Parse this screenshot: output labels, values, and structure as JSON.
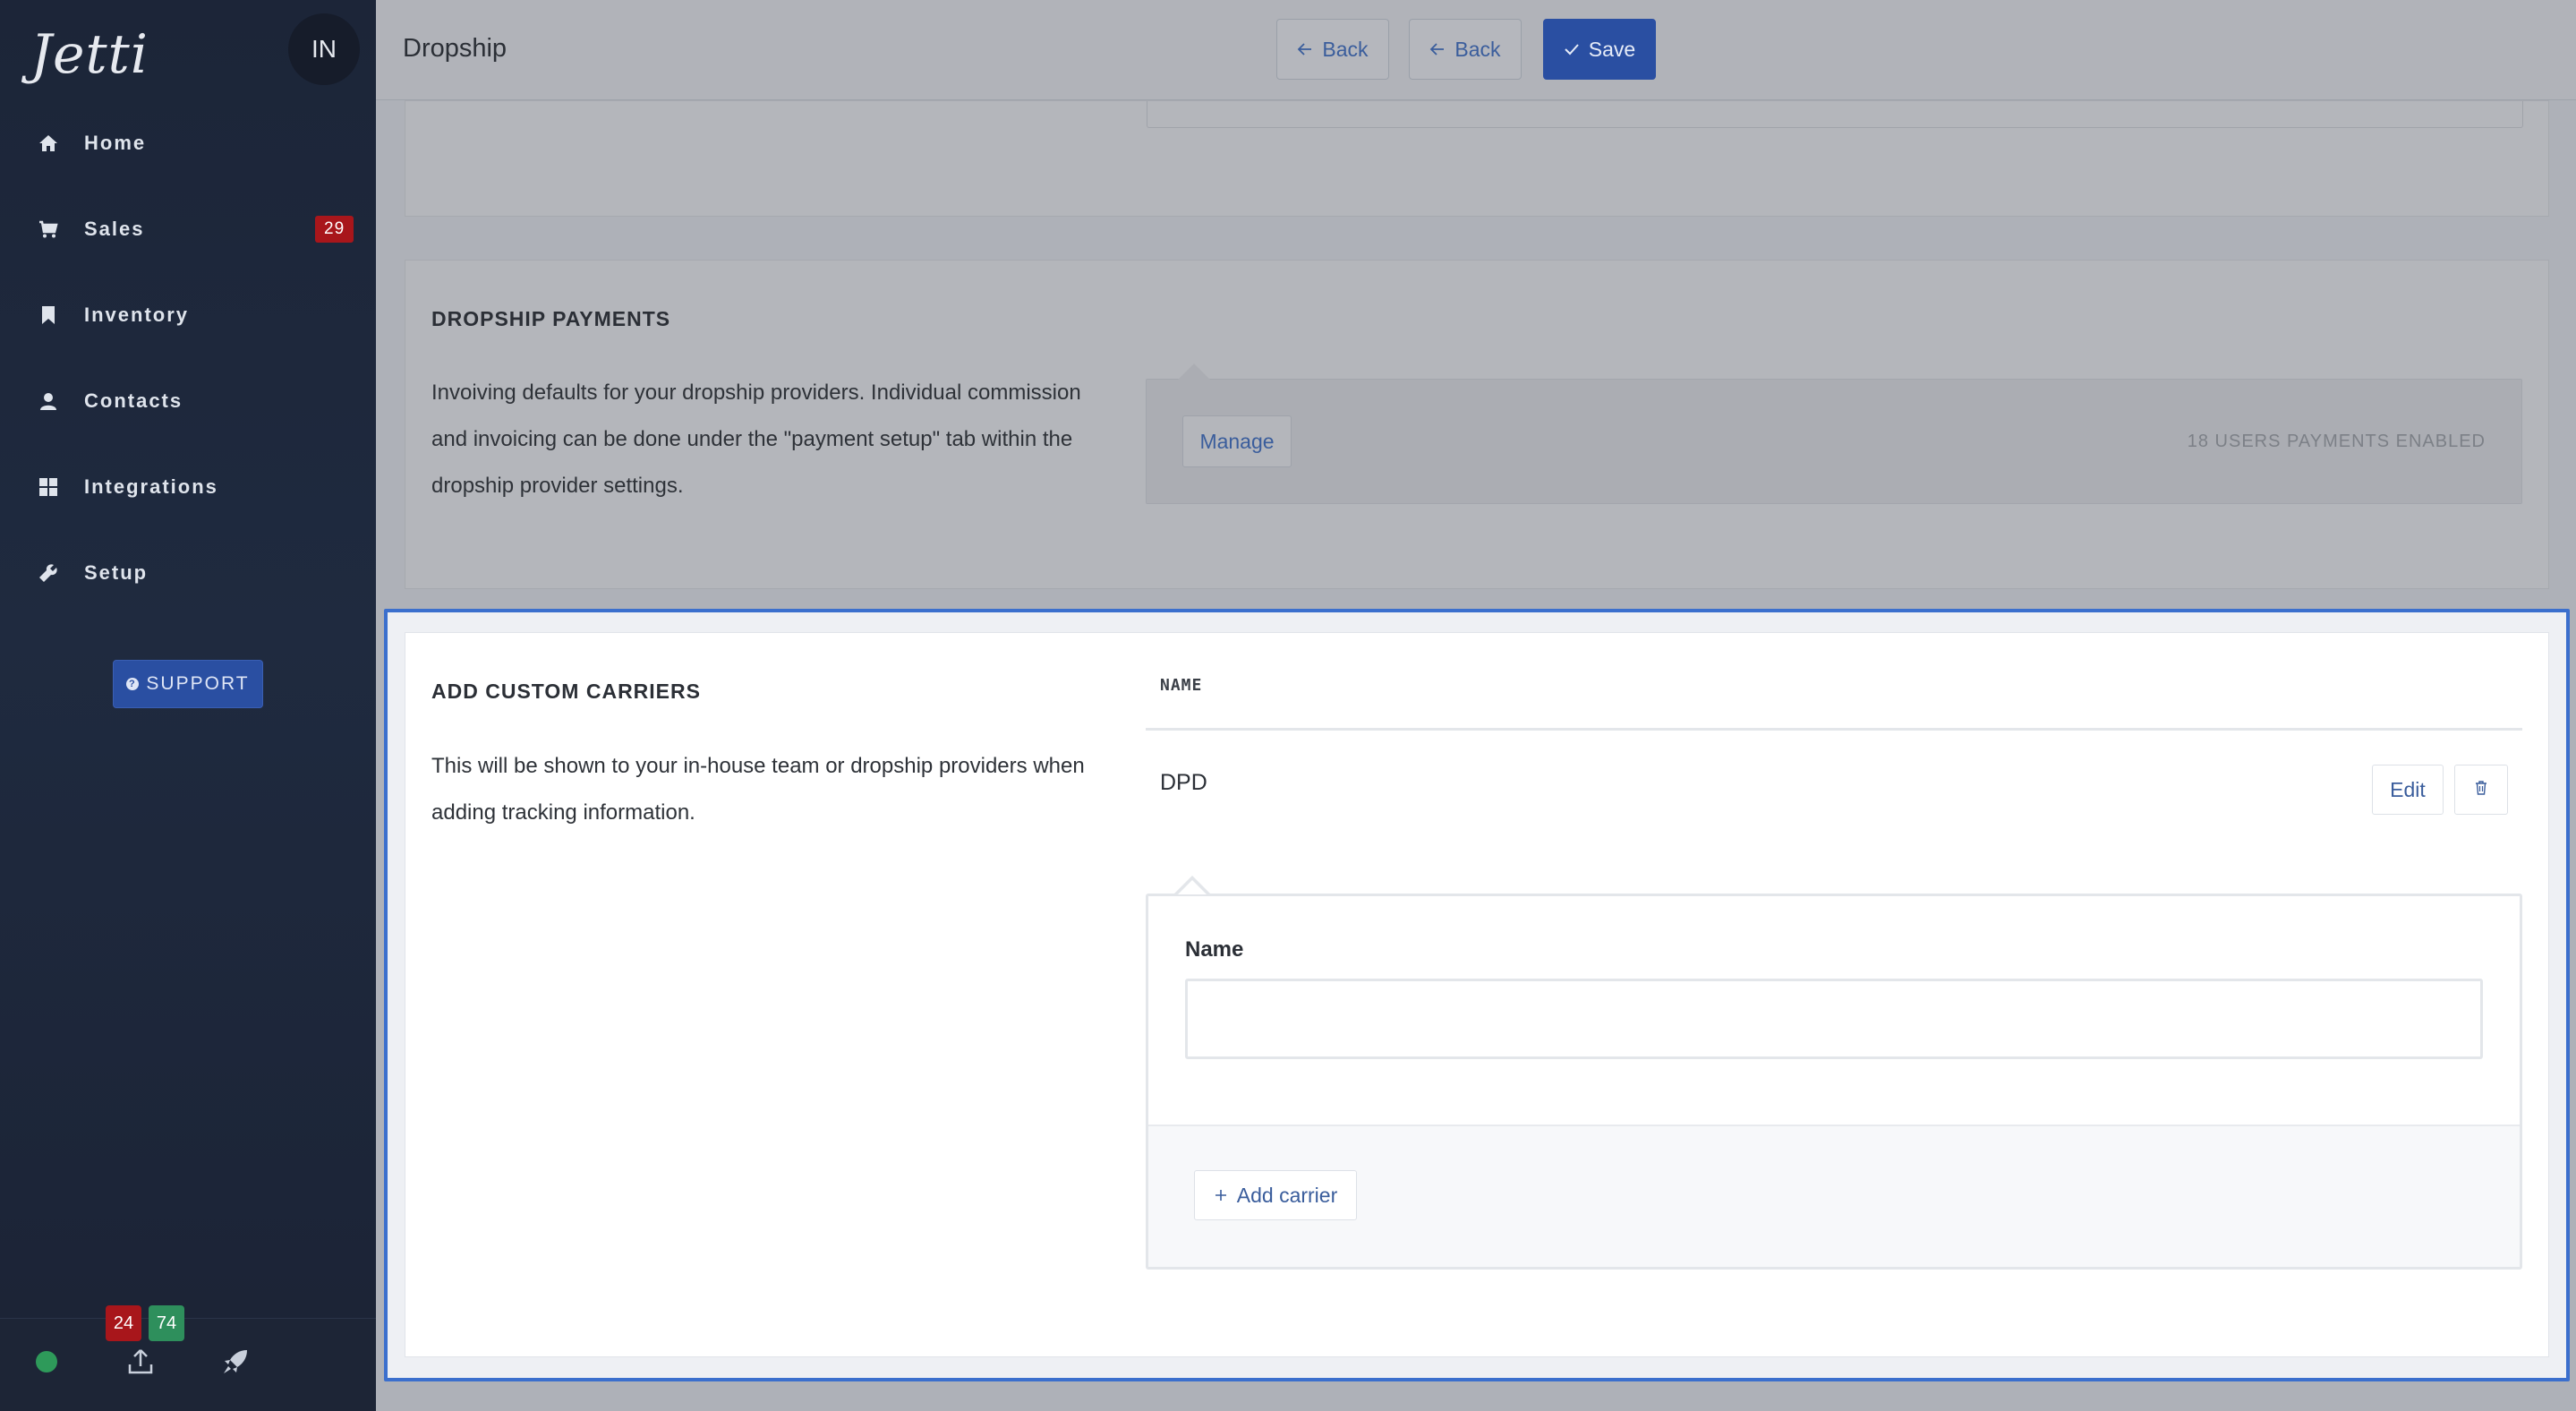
{
  "sidebar": {
    "logo": "Jetti",
    "avatar_initials": "IN",
    "nav": [
      {
        "label": "Home",
        "icon": "home-icon"
      },
      {
        "label": "Sales",
        "icon": "cart-icon",
        "badge": "29"
      },
      {
        "label": "Inventory",
        "icon": "bookmark-icon"
      },
      {
        "label": "Contacts",
        "icon": "user-icon"
      },
      {
        "label": "Integrations",
        "icon": "grid-icon"
      },
      {
        "label": "Setup",
        "icon": "wrench-icon"
      }
    ],
    "support_label": "SUPPORT",
    "footer": {
      "status_color": "#2e9a5a",
      "count_red": "24",
      "count_green": "74",
      "icons": [
        "status-dot",
        "upload-icon",
        "rocket-icon"
      ]
    }
  },
  "header": {
    "title": "Dropship",
    "back_label_1": "Back",
    "back_label_2": "Back",
    "save_label": "Save"
  },
  "payments": {
    "title": "DROPSHIP PAYMENTS",
    "description_lines": [
      "Invoiving defaults for your dropship providers. Individual commission",
      "and invoicing can be done under the \"payment setup\" tab within the",
      "dropship provider settings."
    ],
    "manage_label": "Manage",
    "status": "18 USERS PAYMENTS ENABLED"
  },
  "carriers": {
    "title": "ADD CUSTOM CARRIERS",
    "description_lines": [
      "This will be shown to your in-house team or dropship providers when",
      "adding tracking information."
    ],
    "column_header": "NAME",
    "rows": [
      {
        "name": "DPD",
        "edit_label": "Edit"
      }
    ],
    "form": {
      "label": "Name",
      "value": "",
      "placeholder": ""
    },
    "add_label": "Add carrier"
  },
  "colors": {
    "accent": "#2a4fa2",
    "focus_outline": "#3b6fcd",
    "badge_red": "#a8161b",
    "badge_green": "#2e8f5c"
  }
}
